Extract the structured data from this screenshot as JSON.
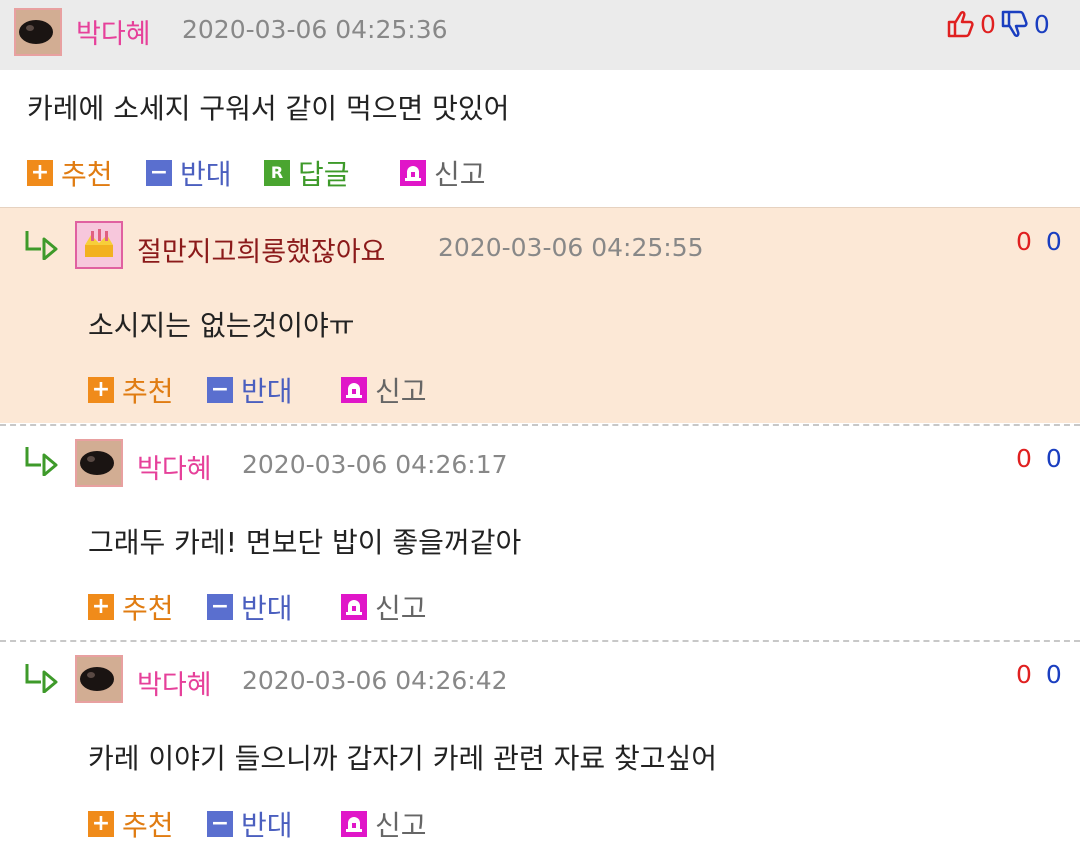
{
  "main_comment": {
    "author": "박다혜",
    "date": "2020-03-06 04:25:36",
    "likes": "0",
    "dislikes": "0",
    "text": "카레에 소세지 구워서 같이 먹으면 맛있어",
    "actions": {
      "recommend": "추천",
      "oppose": "반대",
      "reply": "답글",
      "report": "신고"
    }
  },
  "replies": [
    {
      "author": "절만지고희롱했잖아요",
      "date": "2020-03-06 04:25:55",
      "likes": "0",
      "dislikes": "0",
      "text": "소시지는 없는것이야ㅠ",
      "actions": {
        "recommend": "추천",
        "oppose": "반대",
        "report": "신고"
      }
    },
    {
      "author": "박다혜",
      "date": "2020-03-06 04:26:17",
      "likes": "0",
      "dislikes": "0",
      "text": "그래두 카레! 면보단 밥이 좋을꺼같아",
      "actions": {
        "recommend": "추천",
        "oppose": "반대",
        "report": "신고"
      }
    },
    {
      "author": "박다혜",
      "date": "2020-03-06 04:26:42",
      "likes": "0",
      "dislikes": "0",
      "text": "카레 이야기 들으니까 갑자기 카레 관련 자료 찾고싶어",
      "actions": {
        "recommend": "추천",
        "oppose": "반대",
        "report": "신고"
      }
    }
  ],
  "icons": {
    "recommend": "plus-icon",
    "oppose": "minus-icon",
    "reply": "reply-r-icon",
    "report": "siren-icon",
    "thumbs_up": "thumbs-up-icon",
    "thumbs_down": "thumbs-down-icon",
    "reply_arrow": "reply-arrow-icon"
  },
  "colors": {
    "author_pink": "#e6409a",
    "author_brown": "#8b1a1a",
    "like_red": "#e02020",
    "dislike_blue": "#1a3ec0",
    "highlight_bg": "#fce8d6",
    "header_bg": "#ebebeb"
  }
}
